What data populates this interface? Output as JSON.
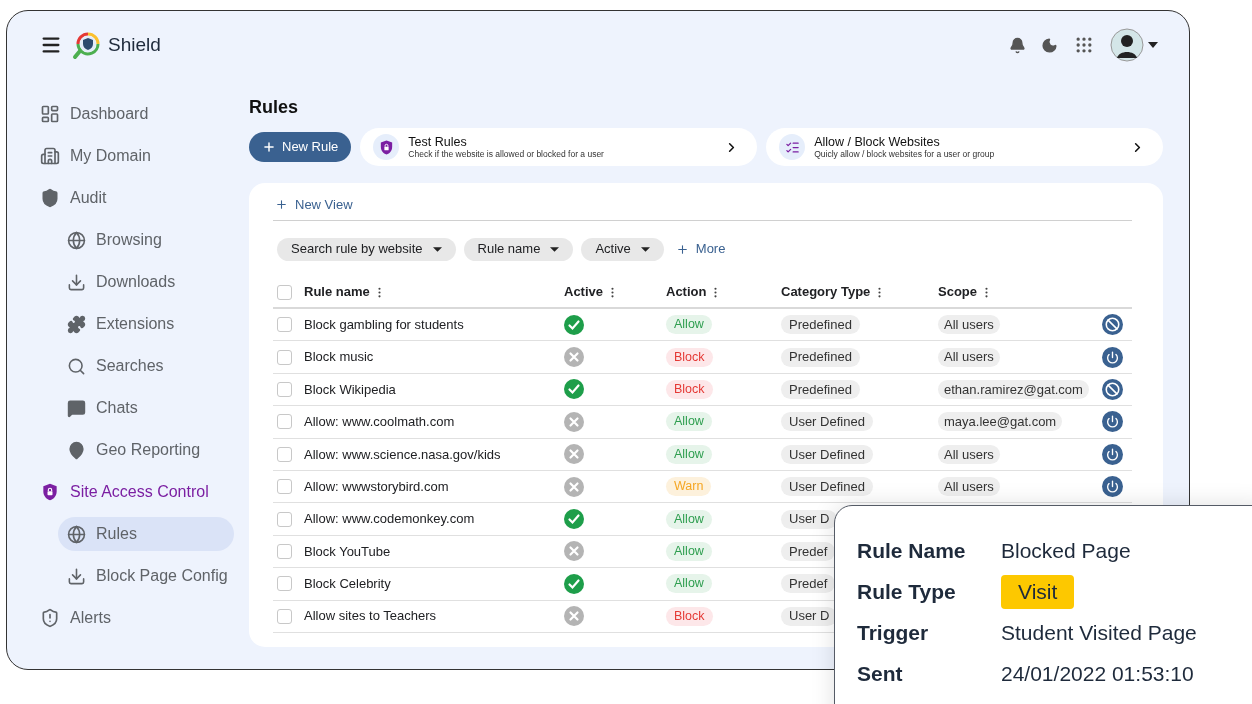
{
  "app": {
    "name": "Shield"
  },
  "sidebar": {
    "items": [
      {
        "label": "Dashboard",
        "selected": false
      },
      {
        "label": "My Domain",
        "selected": false
      },
      {
        "label": "Audit",
        "selected": false,
        "children": [
          {
            "label": "Browsing",
            "selected": false
          },
          {
            "label": "Downloads",
            "selected": false
          },
          {
            "label": "Extensions",
            "selected": false
          },
          {
            "label": "Searches",
            "selected": false
          },
          {
            "label": "Chats",
            "selected": false
          },
          {
            "label": "Geo Reporting",
            "selected": false
          }
        ]
      },
      {
        "label": "Site Access Control",
        "selected": true,
        "children": [
          {
            "label": "Rules",
            "selected": true
          },
          {
            "label": "Block Page Config",
            "selected": false
          }
        ]
      },
      {
        "label": "Alerts",
        "selected": false
      }
    ]
  },
  "page": {
    "title": "Rules",
    "new_rule_button": "New Rule",
    "shortcuts": [
      {
        "title": "Test Rules",
        "subtitle": "Check if the website is allowed or blocked for a user",
        "kind": "shield"
      },
      {
        "title": "Allow / Block Websites",
        "subtitle": "Quicly allow / block websites for a user or group",
        "kind": "list"
      }
    ],
    "new_view": "New View",
    "filters": [
      {
        "label": "Search rule by website"
      },
      {
        "label": "Rule name"
      },
      {
        "label": "Active"
      }
    ],
    "more_filters": "More"
  },
  "table": {
    "select_all": {
      "checked": false
    },
    "columns": [
      {
        "label": "Rule name"
      },
      {
        "label": "Active"
      },
      {
        "label": "Action"
      },
      {
        "label": "Category Type"
      },
      {
        "label": "Scope"
      }
    ],
    "rows": [
      {
        "checked": false,
        "name": "Block gambling for students",
        "active": true,
        "action": {
          "label": "Allow",
          "kind": "allow"
        },
        "category": "Predefined",
        "scope": "All users",
        "status_icon": {
          "kind": "blocked"
        }
      },
      {
        "checked": false,
        "name": "Block music",
        "active": false,
        "action": {
          "label": "Block",
          "kind": "block"
        },
        "category": "Predefined",
        "scope": "All users",
        "status_icon": {
          "kind": "power"
        }
      },
      {
        "checked": false,
        "name": "Block Wikipedia",
        "active": true,
        "action": {
          "label": "Block",
          "kind": "block"
        },
        "category": "Predefined",
        "scope": "ethan.ramirez@gat.com",
        "status_icon": {
          "kind": "blocked"
        }
      },
      {
        "checked": false,
        "name": "Allow: www.coolmath.com",
        "active": false,
        "action": {
          "label": "Allow",
          "kind": "allow"
        },
        "category": "User Defined",
        "scope": "maya.lee@gat.com",
        "status_icon": {
          "kind": "power"
        }
      },
      {
        "checked": false,
        "name": "Allow: www.science.nasa.gov/kids",
        "active": false,
        "action": {
          "label": "Allow",
          "kind": "allow"
        },
        "category": "User Defined",
        "scope": "All users",
        "status_icon": {
          "kind": "power"
        }
      },
      {
        "checked": false,
        "name": "Allow: wwwstorybird.com",
        "active": false,
        "action": {
          "label": "Warn",
          "kind": "warn"
        },
        "category": "User Defined",
        "scope": "All users",
        "status_icon": {
          "kind": "power"
        }
      },
      {
        "checked": false,
        "name": "Allow: www.codemonkey.com",
        "active": true,
        "action": {
          "label": "Allow",
          "kind": "allow"
        },
        "category": "User D"
      },
      {
        "checked": false,
        "name": "Block YouTube",
        "active": false,
        "action": {
          "label": "Allow",
          "kind": "allow"
        },
        "category": "Predef"
      },
      {
        "checked": false,
        "name": "Block Celebrity",
        "active": true,
        "action": {
          "label": "Allow",
          "kind": "allow"
        },
        "category": "Predef"
      },
      {
        "checked": false,
        "name": "Allow sites to Teachers",
        "active": false,
        "action": {
          "label": "Block",
          "kind": "block"
        },
        "category": "User D"
      }
    ]
  },
  "detail_card": {
    "fields": [
      {
        "label": "Rule Name",
        "value": "Blocked Page",
        "kind": "text"
      },
      {
        "label": "Rule Type",
        "value": "Visit",
        "kind": "badge"
      },
      {
        "label": "Trigger",
        "value": "Student Visited Page",
        "kind": "text"
      },
      {
        "label": "Sent",
        "value": "24/01/2022 01:53:10",
        "kind": "text"
      }
    ]
  }
}
